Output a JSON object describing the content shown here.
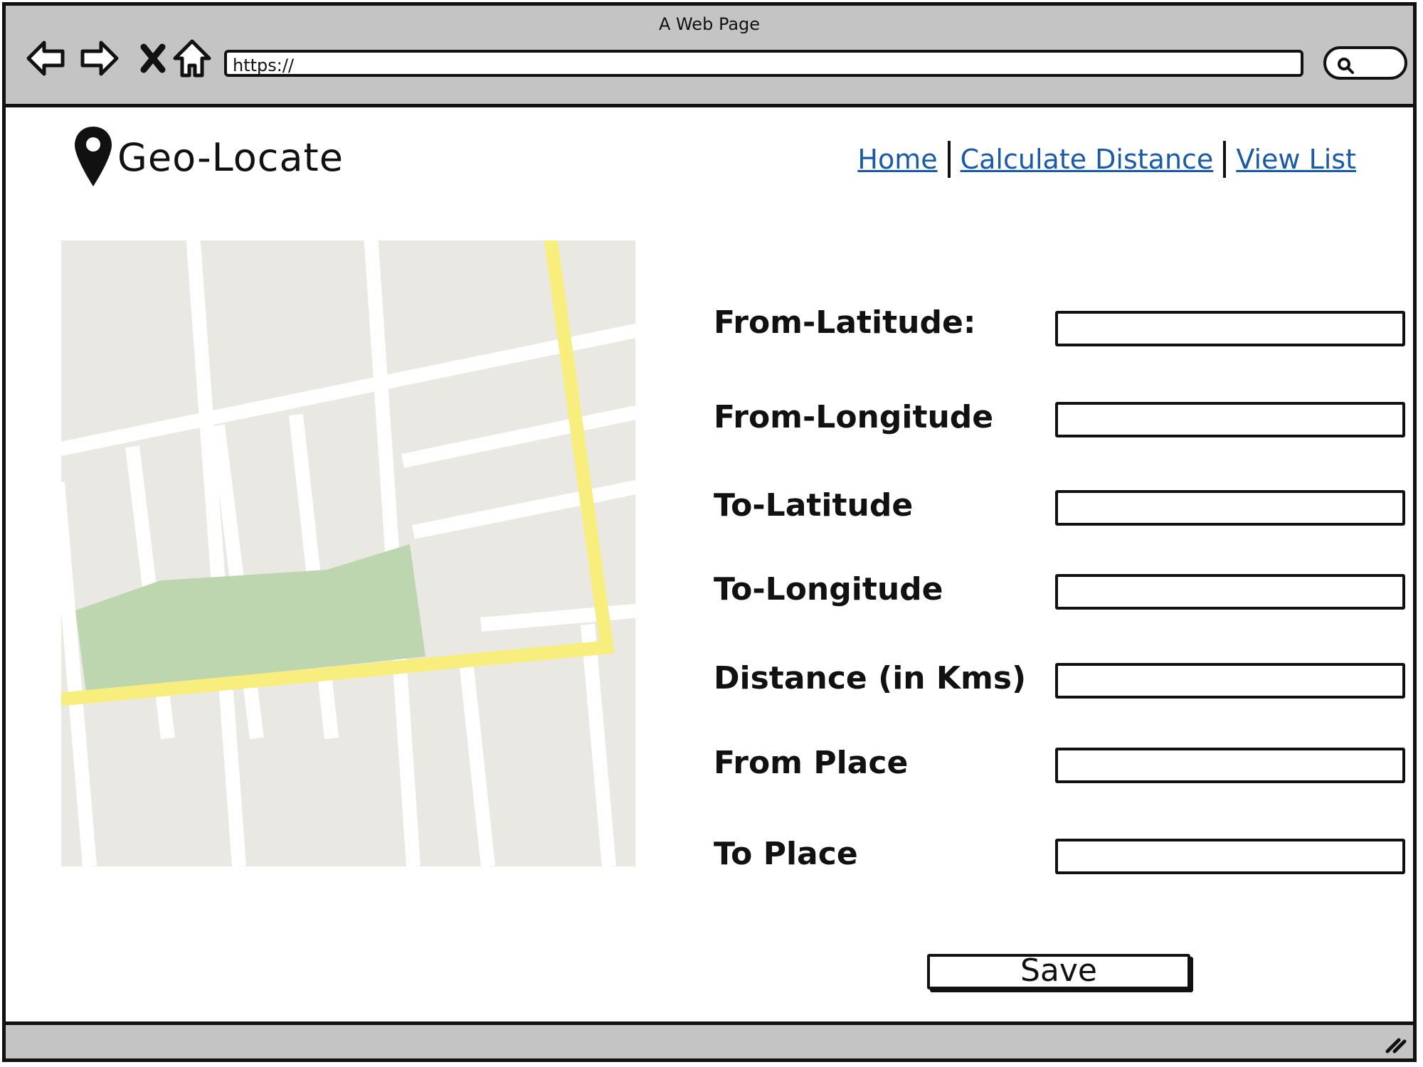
{
  "browser": {
    "title": "A Web Page",
    "url": "https://",
    "icons": [
      "back-arrow-icon",
      "forward-arrow-icon",
      "close-icon",
      "home-icon",
      "search-icon",
      "resize-grip-icon"
    ]
  },
  "header": {
    "logo_text": "Geo-Locate",
    "logo_icon": "map-pin-icon",
    "nav": [
      "Home",
      "Calculate Distance",
      "View List"
    ]
  },
  "form": {
    "fields": [
      {
        "label": "From-Latitude:",
        "value": ""
      },
      {
        "label": "From-Longitude",
        "value": ""
      },
      {
        "label": "To-Latitude",
        "value": ""
      },
      {
        "label": "To-Longitude",
        "value": ""
      },
      {
        "label": "Distance (in Kms)",
        "value": ""
      },
      {
        "label": "From Place",
        "value": ""
      },
      {
        "label": "To Place",
        "value": ""
      }
    ],
    "save_label": "Save"
  },
  "colors": {
    "chrome": "#c4c4c4",
    "link": "#1a5aa6",
    "map_block": "#eae8e2",
    "map_road": "#ffffff",
    "map_highway": "#f7ee7d",
    "map_park": "#bdd6b0"
  }
}
